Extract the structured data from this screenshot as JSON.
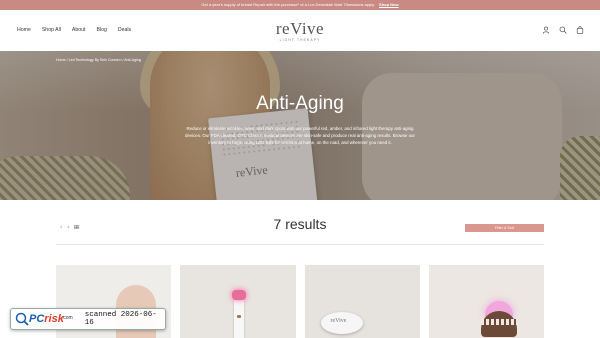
{
  "announcement": {
    "text": "Get a year's supply of breast Repair with the purchase* of a Lux Dermalab Wart 70sessions apply.",
    "cta": "Shop Now"
  },
  "nav": [
    "Home",
    "Shop All",
    "About",
    "Blog",
    "Deals"
  ],
  "logo": {
    "word": "reVive",
    "tagline": "LIGHT THERAPY"
  },
  "header_icons": [
    "user-icon",
    "search-icon",
    "cart-icon"
  ],
  "hero": {
    "breadcrumb": "Home / Led Technology By Skin Concern / Anti-Aging",
    "title": "Anti-Aging",
    "description": "Reduce or eliminate wrinkles, lines, and dark spots with our powerful red, amber, and infrared light therapy anti-aging devices. Our FDA cleared, OTC Class II medical devices are skin-safe and produce real anti-aging results. Browse our inventory to begin using LED light for wrinkles at home, on the road, and wherever you need it.",
    "book_brand": "reVive"
  },
  "results": {
    "count_label": "7 results",
    "view_options": [
      "3",
      "4"
    ],
    "filter_label": "Filter & Sort"
  },
  "product_images": [
    "product-1",
    "product-2",
    "product-3",
    "product-4"
  ],
  "product_3_brand": "reVive",
  "watermark": {
    "brand": "PC",
    "brand_accent": "risk",
    "domain": ".com",
    "scan_text": "scanned 2026-06-16"
  },
  "colors": {
    "announcement_bg": "#c98a83",
    "filter_button": "#d99790",
    "hero_text": "#ffffff"
  }
}
